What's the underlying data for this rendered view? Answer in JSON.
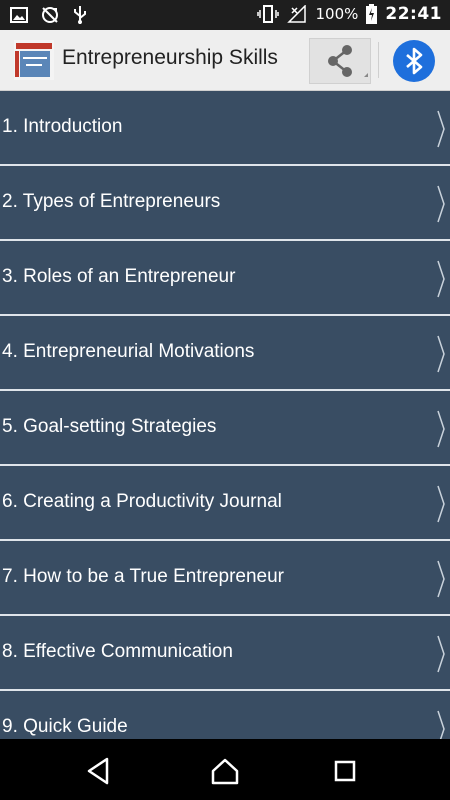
{
  "status_bar": {
    "left_icons": [
      "image-icon",
      "sync-off-icon",
      "usb-icon"
    ],
    "battery_percent": "100%",
    "time": "22:41"
  },
  "app_bar": {
    "title": "Entrepreneurship Skills",
    "logo_text": "Entrepreneurship Skills"
  },
  "menu": {
    "items": [
      {
        "label": "1. Introduction"
      },
      {
        "label": "2. Types of Entrepreneurs"
      },
      {
        "label": "3. Roles of an Entrepreneur"
      },
      {
        "label": "4. Entrepreneurial Motivations"
      },
      {
        "label": "5. Goal-setting Strategies"
      },
      {
        "label": "6. Creating a Productivity Journal"
      },
      {
        "label": "7. How to be a True Entrepreneur"
      },
      {
        "label": "8. Effective Communication"
      },
      {
        "label": "9. Quick Guide"
      }
    ]
  },
  "colors": {
    "list_background": "#394d63",
    "divider": "#dfe4ea",
    "app_bar": "#eeeeee",
    "bluetooth": "#1e6fdc"
  }
}
